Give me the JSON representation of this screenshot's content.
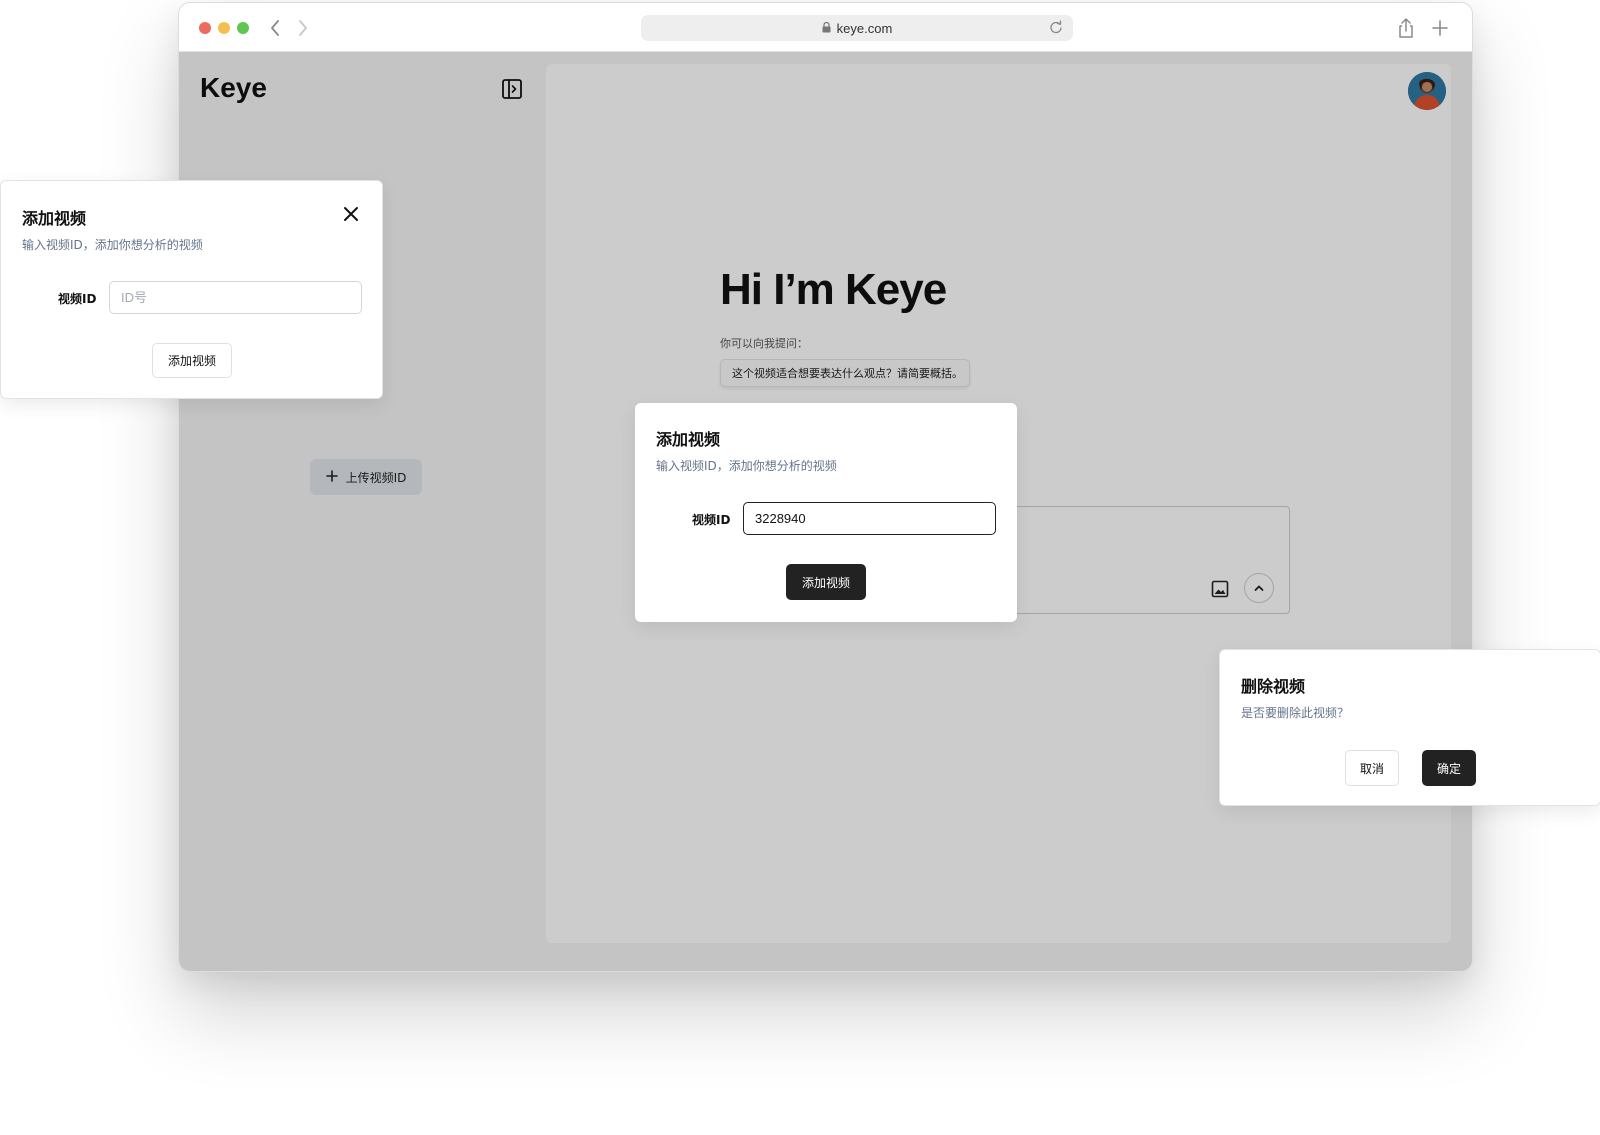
{
  "browser": {
    "url": "keye.com"
  },
  "app": {
    "logo": "Keye",
    "upload_button_label": "上传视频ID",
    "hero_title": "Hi I’m Keye",
    "hint_label": "你可以向我提问：",
    "suggestion": "这个视频适合想要表达什么观点？请简要概括。"
  },
  "dialog_left": {
    "title": "添加视频",
    "description": "输入视频ID，添加你想分析的视频",
    "field_label": "视频ID",
    "placeholder": "ID号",
    "value": "",
    "button_label": "添加视频"
  },
  "dialog_center": {
    "title": "添加视频",
    "description": "输入视频ID，添加你想分析的视频",
    "field_label": "视频ID",
    "value": "3228940",
    "button_label": "添加视频"
  },
  "dialog_delete": {
    "title": "删除视频",
    "description": "是否要删除此视频？",
    "cancel_label": "取消",
    "confirm_label": "确定"
  },
  "colors": {
    "primary_button": "#222222",
    "description_text": "#64748b",
    "overlay": "rgba(0,0,0,0.2)",
    "traffic_red": "#ed6a5e",
    "traffic_yellow": "#f5bf4f",
    "traffic_green": "#61c554"
  },
  "icons": {
    "close": "close-icon",
    "sidebar_toggle": "sidebar-toggle-icon",
    "plus": "plus-icon",
    "image": "image-icon",
    "send": "chevron-up-icon",
    "lock": "lock-icon",
    "reload": "reload-icon",
    "share": "share-icon",
    "new_tab": "plus-icon"
  }
}
